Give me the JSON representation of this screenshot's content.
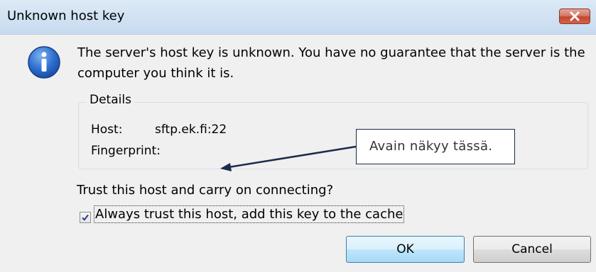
{
  "dialog": {
    "title": "Unknown host key",
    "message": "The server's host key is unknown. You have no guarantee that the server is the computer you think it is.",
    "details": {
      "legend": "Details",
      "host_label": "Host:",
      "host_value": "sftp.ek.fi:22",
      "fingerprint_label": "Fingerprint:",
      "fingerprint_value": ""
    },
    "question": "Trust this host and carry on connecting?",
    "checkbox": {
      "label": "Always trust this host, add this key to the cache",
      "checked": true
    },
    "buttons": {
      "ok": "OK",
      "cancel": "Cancel"
    }
  },
  "annotation": {
    "callout_text": "Avain näkyy tässä."
  },
  "colors": {
    "close_button": "#c5442c",
    "callout_border": "#1c2b4a",
    "arrow": "#1c2b4a"
  }
}
